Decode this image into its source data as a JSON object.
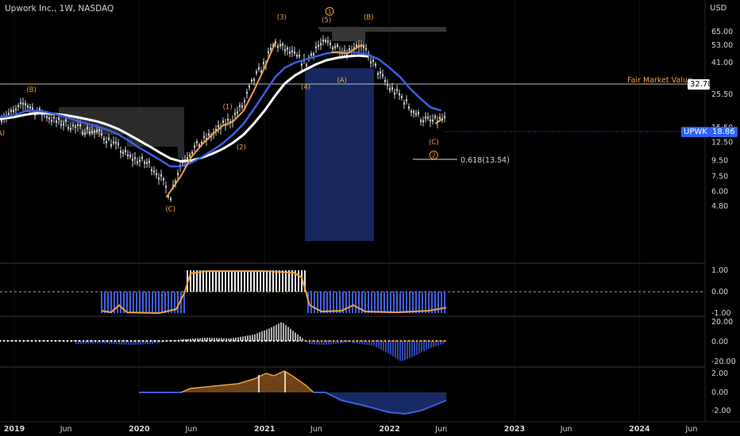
{
  "header": {
    "title": "Upwork Inc., 1W, NASDAQ",
    "currency": "USD"
  },
  "colors": {
    "background": "#000000",
    "ema_fast": "#3d5ee0",
    "ema_slow": "#ffffff",
    "short_ma": "#f0a040",
    "orange": "#f0a040",
    "blue": "#2962ff",
    "candle": "#cfd2da",
    "shade_gray": "#3a3a3a",
    "shade_blue": "#1a2f6e"
  },
  "price_axis": {
    "ticks": [
      "65.00",
      "53.00",
      "41.00",
      "25.50",
      "15.50",
      "12.50",
      "9.50",
      "7.50",
      "6.00",
      "4.80"
    ]
  },
  "time_axis": {
    "labels": [
      "2019",
      "Jun",
      "2020",
      "Jun",
      "2021",
      "Jun",
      "2022",
      "Jun",
      "2023",
      "Jun",
      "2024",
      "Jun"
    ]
  },
  "fair_market": {
    "label": "Fair Market Value",
    "value": "32.78"
  },
  "last_price": {
    "symbol": "UPWK",
    "value": "18.86"
  },
  "fib": {
    "label": "0.618(13.54)"
  },
  "wave_labels": [
    {
      "text": "(A)",
      "date": "2018-11-20",
      "price": 13.8
    },
    {
      "text": "(B)",
      "date": "2019-02-20",
      "price": 26.5
    },
    {
      "text": "(C)",
      "date": "2020-04-01",
      "price": 4.45
    },
    {
      "text": "(1)",
      "date": "2020-09-15",
      "price": 20.5
    },
    {
      "text": "(2)",
      "date": "2020-10-25",
      "price": 11.2
    },
    {
      "text": "(3)",
      "date": "2021-02-20",
      "price": 78
    },
    {
      "text": "(4)",
      "date": "2021-05-01",
      "price": 27.5
    },
    {
      "text": "(5)",
      "date": "2021-07-01",
      "price": 75
    },
    {
      "text": "(A)",
      "date": "2021-08-15",
      "price": 30.5
    },
    {
      "text": "(B)",
      "date": "2021-11-01",
      "price": 78
    },
    {
      "text": "(C)",
      "date": "2022-05-10",
      "price": 12.1
    }
  ],
  "circle_labels": [
    {
      "text": "1",
      "date": "2021-07-10",
      "price": 88
    },
    {
      "text": "2",
      "date": "2022-05-10",
      "price": 10.3
    }
  ],
  "oscillators": {
    "osc1": {
      "ticks": [
        "1.00",
        "0.00",
        "-1.00"
      ]
    },
    "osc2": {
      "ticks": [
        "20.00",
        "0.00",
        "-20.00"
      ]
    },
    "osc3": {
      "ticks": [
        "2.00",
        "0.00",
        "-2.00"
      ]
    }
  },
  "chart_data": [
    {
      "type": "line",
      "title": "Upwork Inc., 1W, NASDAQ",
      "log_scale": true,
      "x": [
        "2018-11-01",
        "2018-12-01",
        "2019-01-01",
        "2019-02-01",
        "2019-03-01",
        "2019-04-01",
        "2019-05-01",
        "2019-06-01",
        "2019-07-01",
        "2019-08-01",
        "2019-09-01",
        "2019-10-01",
        "2019-11-01",
        "2019-12-01",
        "2020-01-01",
        "2020-02-01",
        "2020-03-01",
        "2020-04-01",
        "2020-05-01",
        "2020-06-01",
        "2020-07-01",
        "2020-08-01",
        "2020-09-01",
        "2020-10-01",
        "2020-11-01",
        "2020-12-01",
        "2021-01-01",
        "2021-02-01",
        "2021-03-01",
        "2021-04-01",
        "2021-05-01",
        "2021-06-01",
        "2021-07-01",
        "2021-08-01",
        "2021-09-01",
        "2021-10-01",
        "2021-11-01",
        "2021-12-01",
        "2022-01-01",
        "2022-02-01",
        "2022-03-01",
        "2022-04-01",
        "2022-05-01",
        "2022-06-01"
      ],
      "series": [
        {
          "name": "",
          "values": [
            17.5,
            18.5,
            19.5,
            22.5,
            20,
            19,
            17,
            16.5,
            15.5,
            15,
            14.5,
            13,
            11.5,
            10,
            9.5,
            9,
            7.5,
            5.5,
            9,
            11,
            12.5,
            14,
            16,
            18,
            22,
            32,
            40,
            55,
            50,
            45,
            40,
            52,
            55,
            52,
            48,
            55,
            45,
            35,
            28,
            25,
            21,
            18,
            17,
            17.5
          ]
        },
        {
          "name": "",
          "values": [
            18,
            18.2,
            18.7,
            19.8,
            20,
            19.7,
            19,
            18.2,
            17.3,
            16.5,
            15.8,
            15,
            14,
            12.8,
            11.5,
            10.5,
            9.6,
            8.7,
            8.7,
            9.2,
            10,
            11,
            12.3,
            14,
            16.5,
            20.5,
            26,
            33,
            38,
            41,
            43,
            45,
            47,
            48,
            48,
            47.5,
            46,
            43,
            38,
            33,
            28,
            24,
            21,
            20
          ]
        },
        {
          "name": "",
          "values": [
            17.5,
            17.8,
            18.2,
            18.8,
            19.2,
            19.3,
            19,
            18.7,
            18.2,
            17.6,
            17,
            16.2,
            15.2,
            14,
            12.8,
            11.7,
            10.7,
            9.8,
            9.4,
            9.5,
            9.9,
            10.5,
            11.3,
            12.4,
            14,
            16.5,
            20,
            25,
            30,
            34,
            37,
            40,
            42.5,
            44,
            45,
            45.5,
            45
          ]
        }
      ]
    }
  ]
}
